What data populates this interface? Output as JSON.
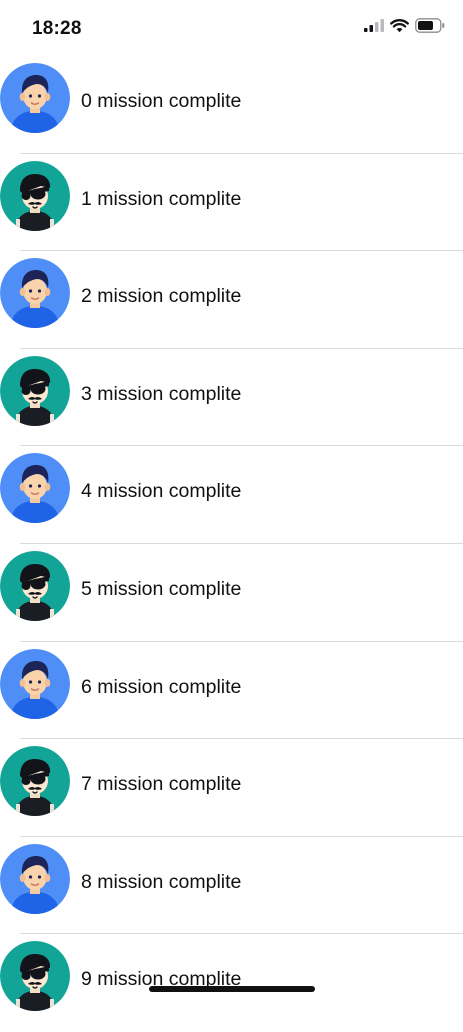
{
  "status_bar": {
    "time": "18:28",
    "icons": [
      "cellular-signal-icon",
      "wifi-icon",
      "battery-icon"
    ]
  },
  "list": {
    "items": [
      {
        "label": "0 mission complite",
        "avatar": "blue-boy-avatar"
      },
      {
        "label": "1 mission complite",
        "avatar": "teal-sunglasses-avatar"
      },
      {
        "label": "2 mission complite",
        "avatar": "blue-boy-avatar"
      },
      {
        "label": "3 mission complite",
        "avatar": "teal-sunglasses-avatar"
      },
      {
        "label": "4 mission complite",
        "avatar": "blue-boy-avatar"
      },
      {
        "label": "5 mission complite",
        "avatar": "teal-sunglasses-avatar"
      },
      {
        "label": "6 mission complite",
        "avatar": "blue-boy-avatar"
      },
      {
        "label": "7 mission complite",
        "avatar": "teal-sunglasses-avatar"
      },
      {
        "label": "8 mission complite",
        "avatar": "blue-boy-avatar"
      },
      {
        "label": "9 mission complite",
        "avatar": "teal-sunglasses-avatar"
      }
    ]
  },
  "colors": {
    "blue_avatar_bg": "#4f8ef7",
    "teal_avatar_bg": "#12a597",
    "separator": "#d9d9de"
  }
}
